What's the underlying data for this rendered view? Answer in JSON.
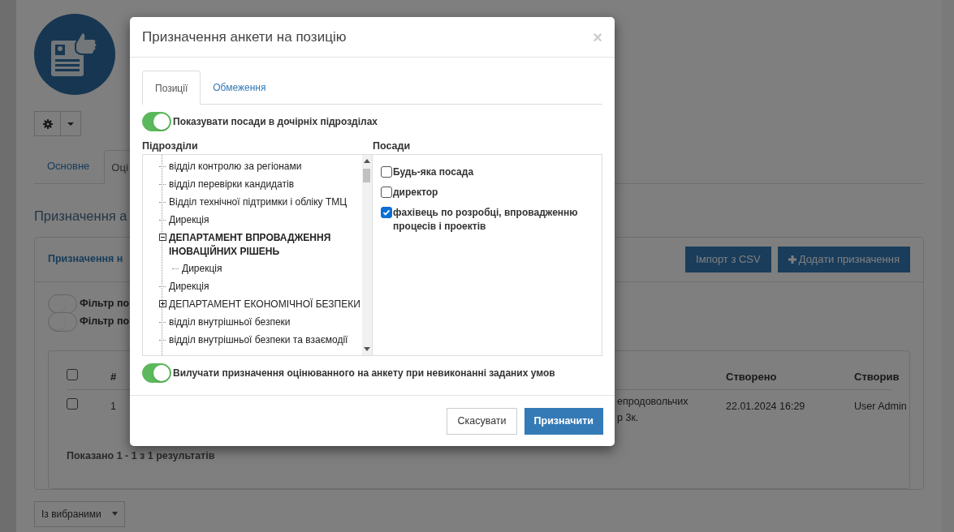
{
  "page": {
    "tabs": [
      {
        "label": "Основне",
        "selected": false
      },
      {
        "label": "Оці",
        "selected": true
      }
    ],
    "heading": "Призначення а",
    "panel": {
      "title": "Призначення н",
      "buttons": [
        {
          "label": "Імпорт з CSV",
          "kind": "plain"
        },
        {
          "label": "Додати призначення",
          "kind": "add"
        }
      ],
      "filters": [
        {
          "label": "Фільтр по",
          "on": false
        },
        {
          "label": "Фільтр по",
          "on": false
        }
      ],
      "table": {
        "header_checked": false,
        "columns": [
          "#",
          "",
          "Створено",
          "Створив"
        ],
        "rows": [
          {
            "checked": false,
            "cells": [
              [
                "1"
              ],
              [
                "епродовольчих",
                "р 3к."
              ],
              [
                "22.01.2024 16:29"
              ],
              [
                "User Admin"
              ]
            ]
          }
        ],
        "summary": "Показано 1 - 1 з 1 результатів"
      },
      "bulk_select": "Із вибраними"
    }
  },
  "dialog": {
    "title": "Призначення анкети на позицію",
    "close": "×",
    "tabs": [
      {
        "label": "Позиції",
        "selected": true
      },
      {
        "label": "Обмеження",
        "selected": false
      }
    ],
    "show_child_positions": {
      "label": "Показувати посади в дочірніх підрозділах",
      "on": true
    },
    "units": {
      "label": "Підрозділи",
      "items": [
        {
          "label": "відділ контролю за регіонами",
          "expanded": false,
          "selected": false
        },
        {
          "label": "відділ перевірки кандидатів",
          "expanded": false,
          "selected": false
        },
        {
          "label": "Відділ технічної підтримки і обліку ТМЦ",
          "expanded": false,
          "selected": false
        },
        {
          "label": "Дирекція",
          "expanded": false,
          "selected": false
        },
        {
          "label": "ДЕПАРТАМЕНТ ВПРОВАДЖЕННЯ ІНОВАЦІЙНИХ РІШЕНЬ",
          "expanded": true,
          "selected": true,
          "children": [
            {
              "label": "Дирекція",
              "expanded": false,
              "selected": false
            }
          ]
        },
        {
          "label": "Дирекція",
          "expanded": false,
          "selected": false
        },
        {
          "label": "ДЕПАРТАМЕНТ ЕКОНОМІЧНОЇ БЕЗПЕКИ",
          "expanded": false,
          "selected": false,
          "kind": "branch"
        },
        {
          "label": "відділ внутрішньої безпеки",
          "expanded": false,
          "selected": false
        },
        {
          "label": "відділ внутрішньої безпеки та взаємодії",
          "expanded": false,
          "selected": false
        }
      ]
    },
    "positions": {
      "label": "Посади",
      "items": [
        {
          "label": "Будь-яка посада",
          "checked": false
        },
        {
          "label": "директор",
          "checked": false
        },
        {
          "label": "фахівець по розробці, впровадженню процесів і проектів",
          "checked": true
        }
      ]
    },
    "exclude_on_fail": {
      "label": "Вилучати призначення оцінюванного на анкету при невиконанні заданих умов",
      "on": true
    },
    "buttons": [
      {
        "label": "Скасувати",
        "kind": "secondary"
      },
      {
        "label": "Призначити",
        "kind": "primary"
      }
    ]
  }
}
